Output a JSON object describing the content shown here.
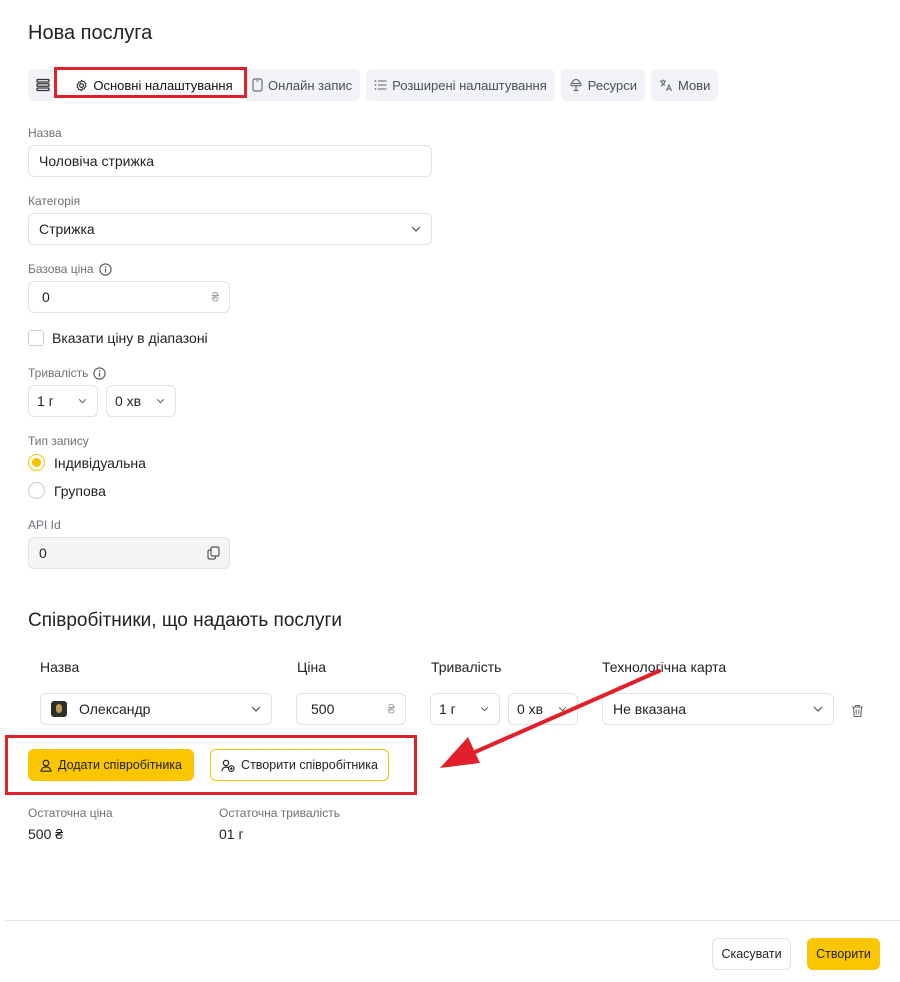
{
  "page": {
    "title": "Нова послуга"
  },
  "tabs": [
    {
      "label": "",
      "icon": "list-icon"
    },
    {
      "label": "Основні налаштування",
      "icon": "gear-icon"
    },
    {
      "label": "Онлайн запис",
      "icon": "phone-icon"
    },
    {
      "label": "Розширені налаштування",
      "icon": "list-bullets-icon"
    },
    {
      "label": "Ресурси",
      "icon": "resource-icon"
    },
    {
      "label": "Мови",
      "icon": "translate-icon"
    }
  ],
  "form": {
    "name": {
      "label": "Назва",
      "value": "Чоловіча стрижка"
    },
    "category": {
      "label": "Категорія",
      "value": "Стрижка"
    },
    "base_price": {
      "label": "Базова ціна",
      "value": "0",
      "currency": "₴"
    },
    "price_range": {
      "label": "Вказати ціну в діапазоні",
      "checked": false
    },
    "duration": {
      "label": "Тривалість",
      "hours": "1 г",
      "minutes": "0 хв"
    },
    "booking_type": {
      "label": "Тип запису",
      "options": [
        "Індивідуальна",
        "Групова"
      ],
      "selected": "Індивідуальна"
    },
    "api_id": {
      "label": "API Id",
      "value": "0"
    }
  },
  "staff": {
    "title": "Співробітники, що надають послуги",
    "columns": [
      "Назва",
      "Ціна",
      "Тривалість",
      "Технологічна карта"
    ],
    "rows": [
      {
        "name": "Олександр",
        "price": "500",
        "currency": "₴",
        "hours": "1 г",
        "minutes": "0 хв",
        "tech_card": "Не вказана"
      }
    ],
    "add_button": "Додати співробітника",
    "create_button": "Створити співробітника"
  },
  "summary": {
    "final_price_label": "Остаточна ціна",
    "final_price": "500 ₴",
    "final_duration_label": "Остаточна тривалість",
    "final_duration": "01 г"
  },
  "footer": {
    "cancel": "Скасувати",
    "create": "Створити"
  },
  "colors": {
    "accent": "#f9c600",
    "annotation_red": "#e1202a"
  }
}
